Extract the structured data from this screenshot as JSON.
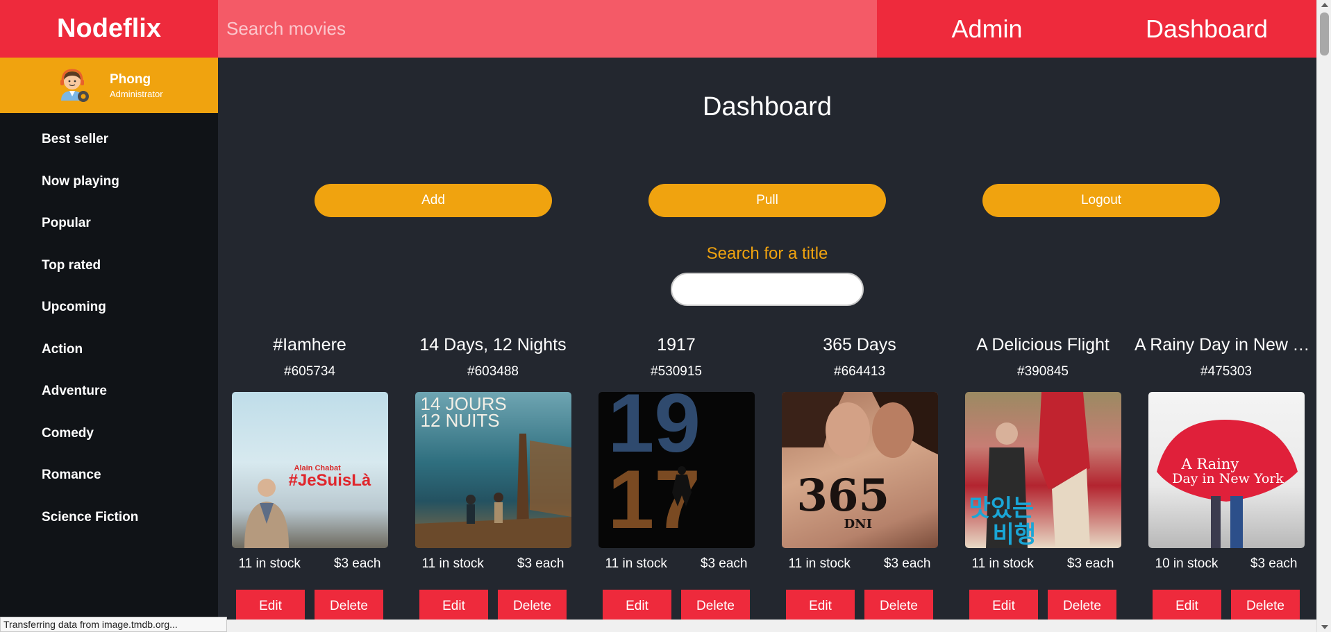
{
  "app": {
    "brand": "Nodeflix"
  },
  "topbar": {
    "search_placeholder": "Search movies",
    "admin_label": "Admin",
    "dashboard_label": "Dashboard"
  },
  "profile": {
    "name": "Phong",
    "role": "Administrator"
  },
  "sidebar": {
    "items": [
      {
        "label": "Best seller"
      },
      {
        "label": "Now playing"
      },
      {
        "label": "Popular"
      },
      {
        "label": "Top rated"
      },
      {
        "label": "Upcoming"
      },
      {
        "label": "Action"
      },
      {
        "label": "Adventure"
      },
      {
        "label": "Comedy"
      },
      {
        "label": "Romance"
      },
      {
        "label": "Science Fiction"
      }
    ]
  },
  "main": {
    "title": "Dashboard",
    "actions": {
      "add": "Add",
      "pull": "Pull",
      "logout": "Logout"
    },
    "search_label": "Search for a title"
  },
  "movies": [
    {
      "title": "#Iamhere",
      "id": "#605734",
      "stock": "11 in stock",
      "price": "$3 each",
      "edit": "Edit",
      "delete": "Delete",
      "poster_text": "#JeSuisLà",
      "poster_sub": "Alain Chabat"
    },
    {
      "title": "14 Days, 12 Nights",
      "id": "#603488",
      "stock": "11 in stock",
      "price": "$3 each",
      "edit": "Edit",
      "delete": "Delete",
      "poster_text": "14 JOURS",
      "poster_sub": "12 NUITS"
    },
    {
      "title": "1917",
      "id": "#530915",
      "stock": "11 in stock",
      "price": "$3 each",
      "edit": "Edit",
      "delete": "Delete",
      "poster_text": "19",
      "poster_sub": "17"
    },
    {
      "title": "365 Days",
      "id": "#664413",
      "stock": "11 in stock",
      "price": "$3 each",
      "edit": "Edit",
      "delete": "Delete",
      "poster_text": "365",
      "poster_sub": "DNI"
    },
    {
      "title": "A Delicious Flight",
      "id": "#390845",
      "stock": "11 in stock",
      "price": "$3 each",
      "edit": "Edit",
      "delete": "Delete",
      "poster_text": "맛있는",
      "poster_sub": "비행"
    },
    {
      "title": "A Rainy Day in New York",
      "id": "#475303",
      "stock": "10 in stock",
      "price": "$3 each",
      "edit": "Edit",
      "delete": "Delete",
      "poster_text": "A Rainy",
      "poster_sub": "Day in New York"
    }
  ],
  "status_bar": "Transferring data from image.tmdb.org...",
  "colors": {
    "primary_red": "#ee2a3c",
    "accent_orange": "#f0a30f",
    "background": "#23272f",
    "sidebar": "#101317"
  }
}
